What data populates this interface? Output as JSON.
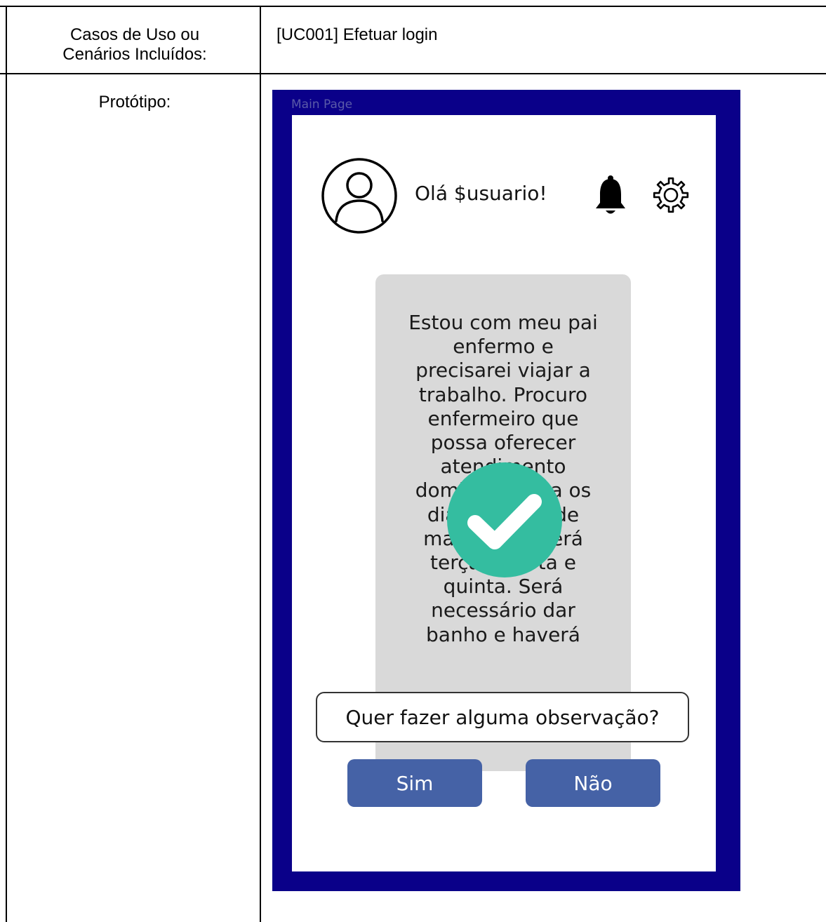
{
  "table": {
    "rows": [
      {
        "label_lines": [
          "Casos de Uso ou",
          "Cenários Incluídos:"
        ],
        "value": "[UC001] Efetuar login"
      },
      {
        "label": "Protótipo:"
      }
    ]
  },
  "prototype": {
    "frame_title": "Main Page",
    "frame_color": "#0a0089",
    "greeting": "Olá $usuario!",
    "icons": [
      "user-avatar-icon",
      "bell-icon",
      "gear-icon",
      "checkmark-icon"
    ],
    "message": "Estou com meu pai enfermo e precisarei viajar a trabalho. Procuro enfermeiro que possa oferecer atendimento domiciliar para os dias 14 a 16 de março, que será terça, quarta e quinta. Será necessário dar banho e haverá",
    "message_lines": [
      "Estou com meu pai",
      "enfermo e",
      "precisarei viajar a",
      "trabalho. Procuro",
      "enfermeiro que",
      "possa oferecer",
      "atendimento",
      "domiciliar para os",
      "dias 14 a 16 de",
      "março, que será",
      "terça, quarta e",
      "quinta. Será",
      "necessário dar",
      "banho e haverá"
    ],
    "success_color": "#34bda0",
    "prompt": "Quer fazer alguma observação?",
    "buttons": {
      "yes": "Sim",
      "no": "Não"
    },
    "button_color": "#4562a6"
  }
}
